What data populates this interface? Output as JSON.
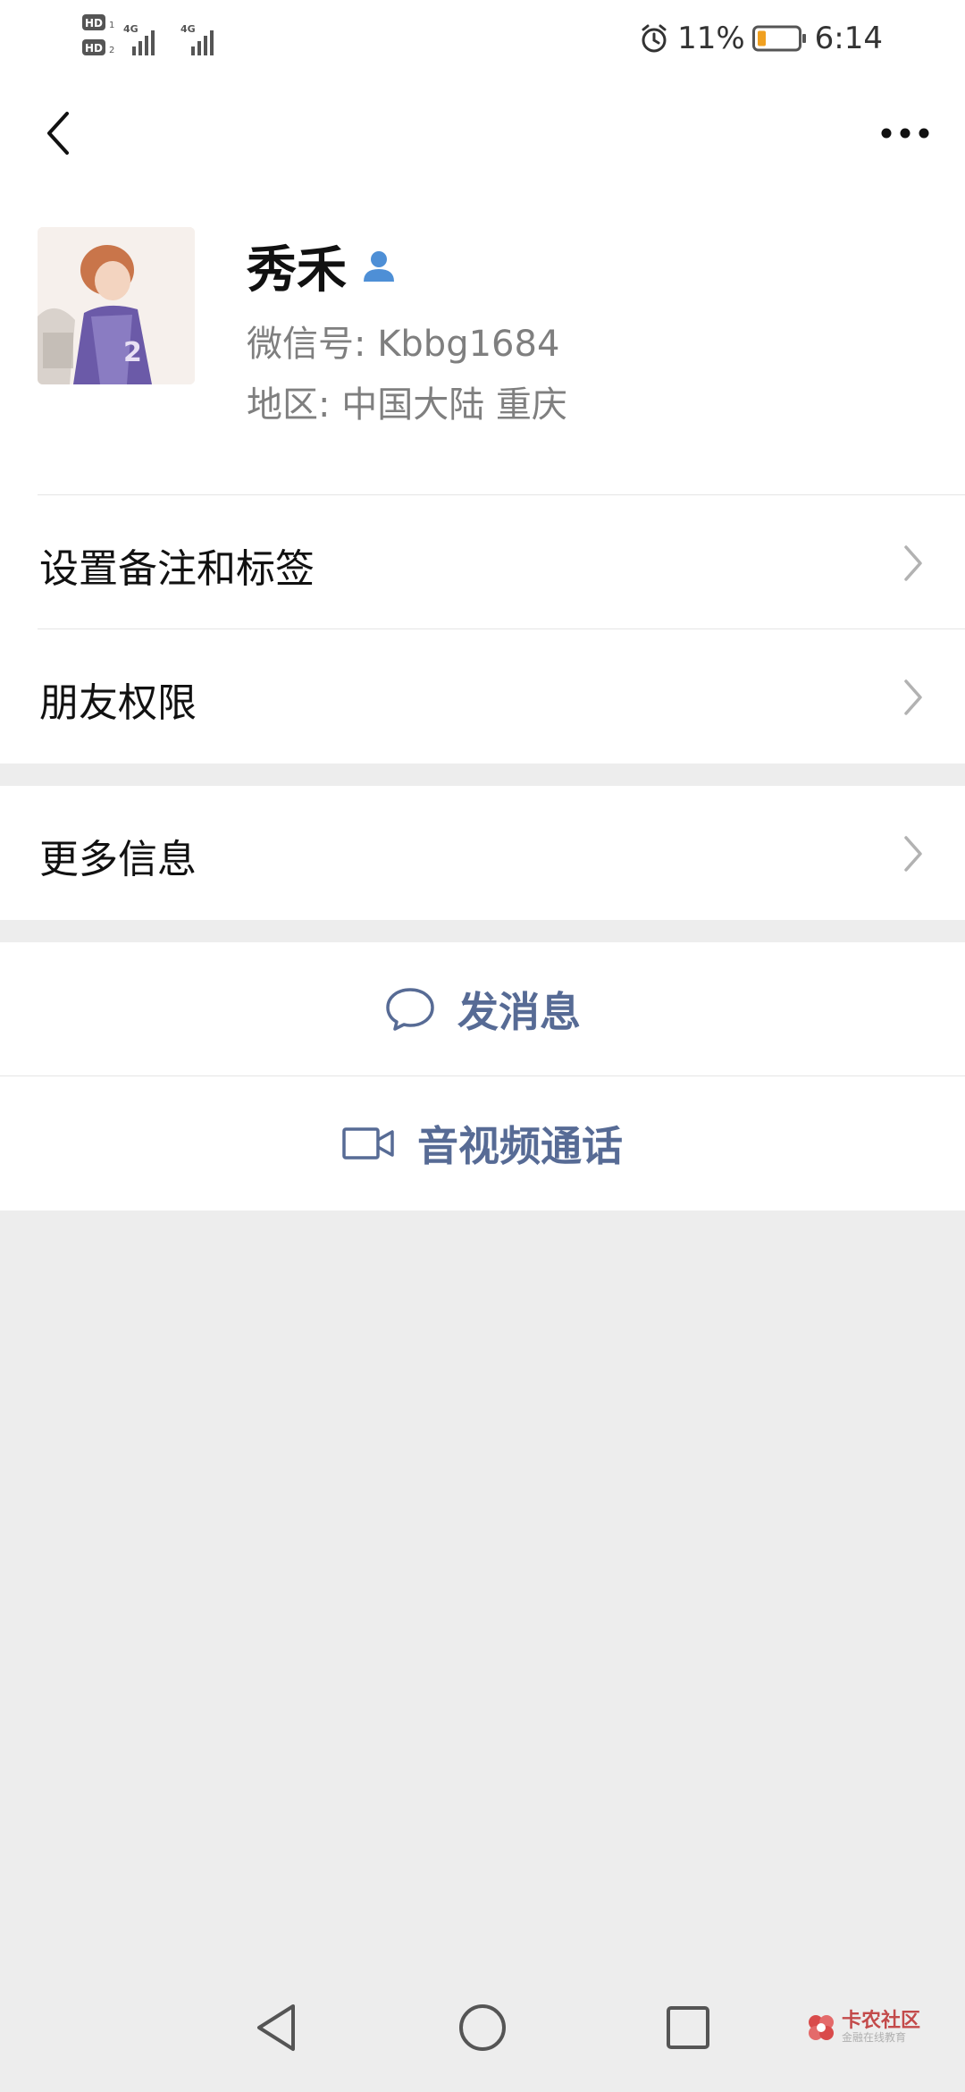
{
  "status": {
    "time": "6:14",
    "battery": "11%",
    "hd1": "HD",
    "hd2": "HD",
    "net1": "4G",
    "net2": "4G"
  },
  "profile": {
    "name": "秀禾",
    "wechat_id": "微信号: Kbbg1684",
    "region": "地区: 中国大陆  重庆"
  },
  "cells": {
    "remark": "设置备注和标签",
    "permissions": "朋友权限",
    "more_info": "更多信息"
  },
  "actions": {
    "message": "发消息",
    "call": "音视频通话"
  },
  "watermark": {
    "title": "卡农社区",
    "subtitle": "金融在线教育"
  },
  "colors": {
    "accent": "#576b95",
    "background": "#ededed",
    "battery_fill": "#f0a020"
  },
  "icons": {
    "back": "back-chevron-icon",
    "more": "more-dots-icon",
    "contact": "contact-person-icon",
    "message": "chat-bubble-icon",
    "video": "video-camera-icon"
  }
}
